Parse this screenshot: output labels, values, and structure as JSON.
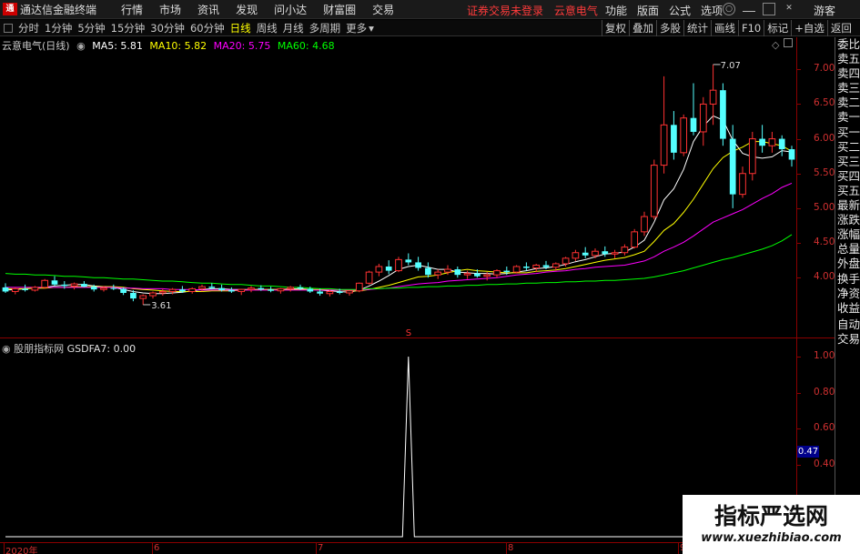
{
  "app": {
    "logo_text": "通",
    "title": "通达信金融终端",
    "menu": [
      "行情",
      "市场",
      "资讯",
      "发现",
      "问小达",
      "财富圈",
      "交易"
    ],
    "status": [
      "证券交易未登录",
      "云意电气"
    ],
    "right_menu": [
      "功能",
      "版面",
      "公式",
      "选项"
    ],
    "guest": "游客"
  },
  "toolbar": {
    "periods": [
      "分时",
      "1分钟",
      "5分钟",
      "15分钟",
      "30分钟",
      "60分钟",
      "日线",
      "周线",
      "月线",
      "多周期",
      "更多"
    ],
    "active_period": "日线",
    "tools": [
      "复权",
      "叠加",
      "多股",
      "统计",
      "画线",
      "F10",
      "标记",
      "+自选",
      "返回"
    ]
  },
  "main_header": {
    "stock": "云意电气(日线)",
    "ma5": "MA5: 5.81",
    "ma10": "MA10: 5.82",
    "ma20": "MA20: 5.75",
    "ma60": "MA60: 4.68",
    "colors": {
      "ma5": "#ffffff",
      "ma10": "#ffff00",
      "ma20": "#ff00ff",
      "ma60": "#00ff00"
    }
  },
  "indicator_header": {
    "name": "股朋指标网",
    "value": "GSDFA7: 0.00"
  },
  "right_panel": [
    "委比",
    "卖五",
    "卖四",
    "卖三",
    "卖二",
    "卖一",
    "买一",
    "买二",
    "买三",
    "买四",
    "买五",
    "最新",
    "涨跌",
    "涨幅",
    "总量",
    "外盘",
    "换手",
    "净资",
    "收益",
    "自动",
    "交易"
  ],
  "price_axis": [
    "7.00",
    "6.50",
    "6.00",
    "5.50",
    "5.00",
    "4.50",
    "4.00"
  ],
  "ind_axis": [
    "1.00",
    "0.80",
    "0.60",
    "0.47",
    "0.40"
  ],
  "date_axis": [
    "2020年",
    "6",
    "7",
    "8",
    "9"
  ],
  "watermark": {
    "title": "指标严选网",
    "url": "www.xuezhibiao.com"
  },
  "chart_data": {
    "type": "candlestick",
    "title": "云意电气(日线)",
    "ylim": [
      3.4,
      7.2
    ],
    "annotations": {
      "high": "7.07",
      "low": "3.61",
      "marker": "S"
    },
    "candles_ohlc": [
      [
        3.86,
        3.92,
        3.78,
        3.8
      ],
      [
        3.8,
        3.86,
        3.76,
        3.84
      ],
      [
        3.84,
        3.9,
        3.8,
        3.82
      ],
      [
        3.82,
        3.88,
        3.8,
        3.86
      ],
      [
        3.86,
        3.98,
        3.84,
        3.96
      ],
      [
        3.96,
        4.02,
        3.88,
        3.9
      ],
      [
        3.9,
        3.95,
        3.84,
        3.88
      ],
      [
        3.88,
        3.93,
        3.83,
        3.91
      ],
      [
        3.91,
        3.95,
        3.86,
        3.87
      ],
      [
        3.87,
        3.9,
        3.8,
        3.83
      ],
      [
        3.83,
        3.88,
        3.8,
        3.85
      ],
      [
        3.85,
        3.9,
        3.82,
        3.84
      ],
      [
        3.84,
        3.86,
        3.75,
        3.78
      ],
      [
        3.78,
        3.82,
        3.66,
        3.7
      ],
      [
        3.7,
        3.76,
        3.61,
        3.74
      ],
      [
        3.74,
        3.8,
        3.7,
        3.78
      ],
      [
        3.78,
        3.84,
        3.74,
        3.8
      ],
      [
        3.8,
        3.85,
        3.76,
        3.83
      ],
      [
        3.83,
        3.88,
        3.78,
        3.8
      ],
      [
        3.8,
        3.86,
        3.77,
        3.84
      ],
      [
        3.84,
        3.9,
        3.8,
        3.87
      ],
      [
        3.87,
        3.92,
        3.83,
        3.85
      ],
      [
        3.85,
        3.9,
        3.8,
        3.82
      ],
      [
        3.82,
        3.86,
        3.78,
        3.8
      ],
      [
        3.8,
        3.84,
        3.75,
        3.83
      ],
      [
        3.83,
        3.88,
        3.79,
        3.85
      ],
      [
        3.85,
        3.89,
        3.81,
        3.83
      ],
      [
        3.83,
        3.87,
        3.79,
        3.81
      ],
      [
        3.81,
        3.85,
        3.77,
        3.84
      ],
      [
        3.84,
        3.88,
        3.8,
        3.86
      ],
      [
        3.86,
        3.9,
        3.82,
        3.84
      ],
      [
        3.84,
        3.87,
        3.78,
        3.8
      ],
      [
        3.8,
        3.84,
        3.74,
        3.77
      ],
      [
        3.77,
        3.82,
        3.73,
        3.8
      ],
      [
        3.8,
        3.84,
        3.76,
        3.78
      ],
      [
        3.78,
        3.82,
        3.74,
        3.81
      ],
      [
        3.81,
        3.93,
        3.79,
        3.92
      ],
      [
        3.92,
        4.1,
        3.9,
        4.08
      ],
      [
        4.08,
        4.2,
        4.02,
        4.16
      ],
      [
        4.16,
        4.25,
        4.05,
        4.1
      ],
      [
        4.1,
        4.3,
        4.08,
        4.26
      ],
      [
        4.26,
        4.35,
        4.18,
        4.22
      ],
      [
        4.22,
        4.3,
        4.1,
        4.14
      ],
      [
        4.14,
        4.22,
        4.0,
        4.04
      ],
      [
        4.04,
        4.12,
        3.98,
        4.08
      ],
      [
        4.08,
        4.18,
        4.04,
        4.12
      ],
      [
        4.12,
        4.16,
        4.0,
        4.04
      ],
      [
        4.04,
        4.1,
        3.98,
        4.06
      ],
      [
        4.06,
        4.12,
        4.0,
        4.02
      ],
      [
        4.02,
        4.08,
        3.96,
        4.04
      ],
      [
        4.04,
        4.12,
        4.0,
        4.1
      ],
      [
        4.1,
        4.16,
        4.04,
        4.08
      ],
      [
        4.08,
        4.18,
        4.06,
        4.16
      ],
      [
        4.16,
        4.22,
        4.1,
        4.14
      ],
      [
        4.14,
        4.2,
        4.08,
        4.18
      ],
      [
        4.18,
        4.24,
        4.12,
        4.15
      ],
      [
        4.15,
        4.22,
        4.1,
        4.2
      ],
      [
        4.2,
        4.3,
        4.16,
        4.28
      ],
      [
        4.28,
        4.4,
        4.24,
        4.36
      ],
      [
        4.36,
        4.44,
        4.28,
        4.32
      ],
      [
        4.32,
        4.42,
        4.28,
        4.38
      ],
      [
        4.38,
        4.45,
        4.3,
        4.34
      ],
      [
        4.34,
        4.4,
        4.28,
        4.36
      ],
      [
        4.36,
        4.48,
        4.32,
        4.44
      ],
      [
        4.44,
        4.7,
        4.42,
        4.66
      ],
      [
        4.66,
        4.95,
        4.6,
        4.88
      ],
      [
        4.88,
        5.7,
        4.84,
        5.62
      ],
      [
        5.62,
        6.9,
        5.5,
        6.2
      ],
      [
        6.2,
        6.4,
        5.7,
        5.8
      ],
      [
        5.8,
        6.35,
        5.75,
        6.3
      ],
      [
        6.3,
        6.8,
        6.05,
        6.1
      ],
      [
        6.1,
        6.6,
        5.9,
        6.5
      ],
      [
        6.5,
        7.07,
        6.2,
        6.7
      ],
      [
        6.7,
        6.8,
        5.9,
        6.0
      ],
      [
        6.0,
        6.2,
        5.0,
        5.2
      ],
      [
        5.2,
        5.6,
        5.15,
        5.5
      ],
      [
        5.5,
        6.1,
        5.4,
        6.0
      ],
      [
        6.0,
        6.2,
        5.8,
        5.9
      ],
      [
        5.9,
        6.1,
        5.8,
        6.0
      ],
      [
        6.0,
        6.05,
        5.75,
        5.85
      ],
      [
        5.85,
        5.9,
        5.6,
        5.7
      ]
    ],
    "ma_series": [
      {
        "name": "MA5",
        "color": "#ffffff",
        "values": [
          3.82,
          3.83,
          3.84,
          3.85,
          3.86,
          3.88,
          3.89,
          3.9,
          3.9,
          3.88,
          3.87,
          3.86,
          3.83,
          3.8,
          3.78,
          3.77,
          3.77,
          3.78,
          3.79,
          3.81,
          3.83,
          3.84,
          3.84,
          3.83,
          3.83,
          3.83,
          3.83,
          3.83,
          3.83,
          3.84,
          3.84,
          3.83,
          3.82,
          3.81,
          3.8,
          3.79,
          3.82,
          3.88,
          3.95,
          4.03,
          4.12,
          4.16,
          4.18,
          4.15,
          4.12,
          4.12,
          4.08,
          4.07,
          4.06,
          4.06,
          4.05,
          4.06,
          4.08,
          4.1,
          4.13,
          4.14,
          4.16,
          4.19,
          4.23,
          4.26,
          4.3,
          4.34,
          4.35,
          4.37,
          4.44,
          4.54,
          4.8,
          5.12,
          5.28,
          5.56,
          5.96,
          6.18,
          6.33,
          6.27,
          5.98,
          5.79,
          5.74,
          5.72,
          5.74,
          5.83,
          5.81
        ]
      },
      {
        "name": "MA10",
        "color": "#ffff00",
        "values": [
          3.84,
          3.84,
          3.84,
          3.85,
          3.85,
          3.86,
          3.86,
          3.87,
          3.87,
          3.87,
          3.87,
          3.87,
          3.86,
          3.84,
          3.83,
          3.82,
          3.81,
          3.8,
          3.8,
          3.8,
          3.8,
          3.81,
          3.81,
          3.81,
          3.82,
          3.83,
          3.83,
          3.83,
          3.83,
          3.83,
          3.83,
          3.83,
          3.83,
          3.82,
          3.82,
          3.81,
          3.81,
          3.83,
          3.86,
          3.89,
          3.93,
          3.97,
          4.01,
          4.02,
          4.04,
          4.07,
          4.1,
          4.12,
          4.1,
          4.09,
          4.08,
          4.07,
          4.07,
          4.07,
          4.09,
          4.1,
          4.11,
          4.13,
          4.16,
          4.19,
          4.22,
          4.25,
          4.27,
          4.29,
          4.33,
          4.38,
          4.52,
          4.68,
          4.78,
          4.94,
          5.13,
          5.35,
          5.57,
          5.73,
          5.82,
          5.88,
          5.96,
          5.96,
          5.93,
          5.9,
          5.82
        ]
      },
      {
        "name": "MA20",
        "color": "#ff00ff",
        "values": [
          3.86,
          3.86,
          3.86,
          3.86,
          3.86,
          3.86,
          3.86,
          3.86,
          3.86,
          3.86,
          3.86,
          3.86,
          3.85,
          3.85,
          3.84,
          3.84,
          3.84,
          3.83,
          3.83,
          3.83,
          3.82,
          3.82,
          3.82,
          3.82,
          3.82,
          3.82,
          3.82,
          3.82,
          3.82,
          3.82,
          3.82,
          3.82,
          3.82,
          3.82,
          3.82,
          3.82,
          3.82,
          3.83,
          3.84,
          3.85,
          3.87,
          3.89,
          3.91,
          3.92,
          3.93,
          3.95,
          3.96,
          3.97,
          3.98,
          3.99,
          4.0,
          4.02,
          4.04,
          4.05,
          4.06,
          4.08,
          4.09,
          4.1,
          4.12,
          4.13,
          4.15,
          4.16,
          4.17,
          4.18,
          4.21,
          4.24,
          4.3,
          4.38,
          4.44,
          4.51,
          4.6,
          4.7,
          4.8,
          4.86,
          4.92,
          4.98,
          5.06,
          5.14,
          5.21,
          5.3,
          5.36
        ]
      },
      {
        "name": "MA60",
        "color": "#00ff00",
        "values": [
          4.06,
          4.05,
          4.05,
          4.04,
          4.04,
          4.03,
          4.02,
          4.02,
          4.01,
          4.0,
          4.0,
          3.99,
          3.98,
          3.98,
          3.97,
          3.96,
          3.95,
          3.95,
          3.94,
          3.93,
          3.92,
          3.92,
          3.91,
          3.9,
          3.9,
          3.89,
          3.88,
          3.88,
          3.87,
          3.86,
          3.86,
          3.85,
          3.84,
          3.84,
          3.83,
          3.83,
          3.83,
          3.84,
          3.84,
          3.85,
          3.85,
          3.86,
          3.86,
          3.87,
          3.87,
          3.88,
          3.88,
          3.89,
          3.89,
          3.9,
          3.9,
          3.91,
          3.91,
          3.92,
          3.92,
          3.93,
          3.93,
          3.94,
          3.94,
          3.95,
          3.95,
          3.96,
          3.96,
          3.97,
          3.98,
          3.99,
          4.01,
          4.04,
          4.07,
          4.1,
          4.14,
          4.18,
          4.22,
          4.26,
          4.29,
          4.33,
          4.37,
          4.41,
          4.46,
          4.53,
          4.62
        ]
      }
    ],
    "indicator": {
      "name": "GSDFA7",
      "ylim": [
        0,
        1.05
      ],
      "spike_index": 41,
      "spike_value": 1.0
    }
  }
}
